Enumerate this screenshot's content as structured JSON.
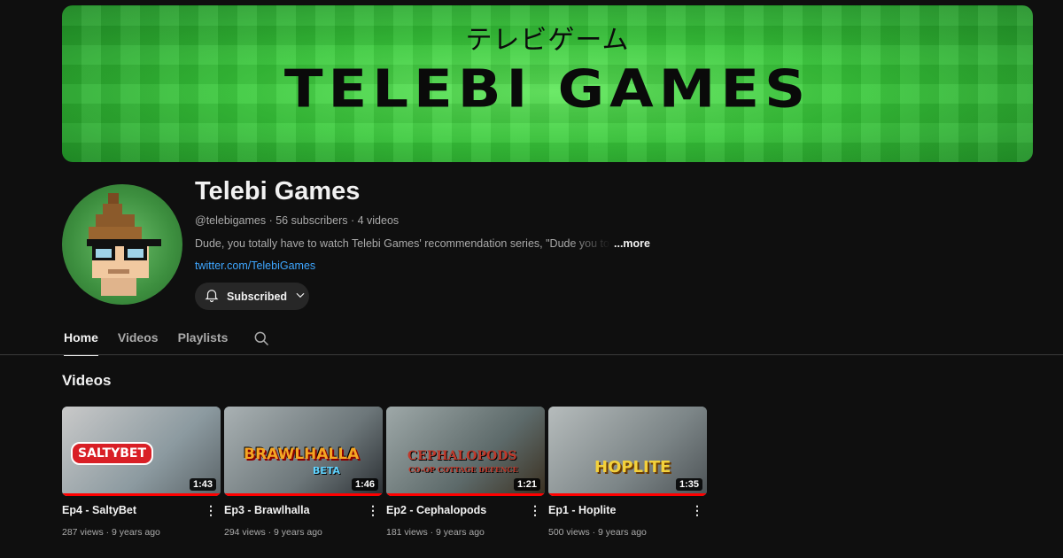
{
  "banner": {
    "subtitle": "テレビゲーム",
    "title": "TELEBI GAMES"
  },
  "channel": {
    "name": "Telebi Games",
    "meta": "@telebigames · 56 subscribers · 4 videos",
    "description": "Dude, you totally have to watch Telebi Games' recommendation series, \"Dude you totally have to play...\"",
    "more_label": "...more",
    "link": "twitter.com/TelebiGames",
    "subscribe_label": "Subscribed"
  },
  "tabs": [
    {
      "label": "Home",
      "active": true
    },
    {
      "label": "Videos",
      "active": false
    },
    {
      "label": "Playlists",
      "active": false
    }
  ],
  "section": {
    "title": "Videos"
  },
  "videos": [
    {
      "title": "Ep4 - SaltyBet",
      "meta": "287 views · 9 years ago",
      "duration": "1:43",
      "logo": "SALTYBET"
    },
    {
      "title": "Ep3 - Brawlhalla",
      "meta": "294 views · 9 years ago",
      "duration": "1:46",
      "logo": "BRAWLHALLA",
      "logo_sub": "BETA"
    },
    {
      "title": "Ep2 - Cephalopods",
      "meta": "181 views · 9 years ago",
      "duration": "1:21",
      "logo": "CEPHALOPODS",
      "logo_sub": "CO-OP COTTAGE DEFENCE"
    },
    {
      "title": "Ep1 - Hoplite",
      "meta": "500 views · 9 years ago",
      "duration": "1:35",
      "logo": "HOPLITE"
    }
  ],
  "icons": {
    "bell": "bell-icon",
    "chevron": "chevron-down-icon",
    "search": "search-icon",
    "kebab": "more-vert-icon"
  },
  "colors": {
    "accent_link": "#3ea6ff",
    "progress": "#ff0000",
    "banner_green": "#2fc33a"
  }
}
